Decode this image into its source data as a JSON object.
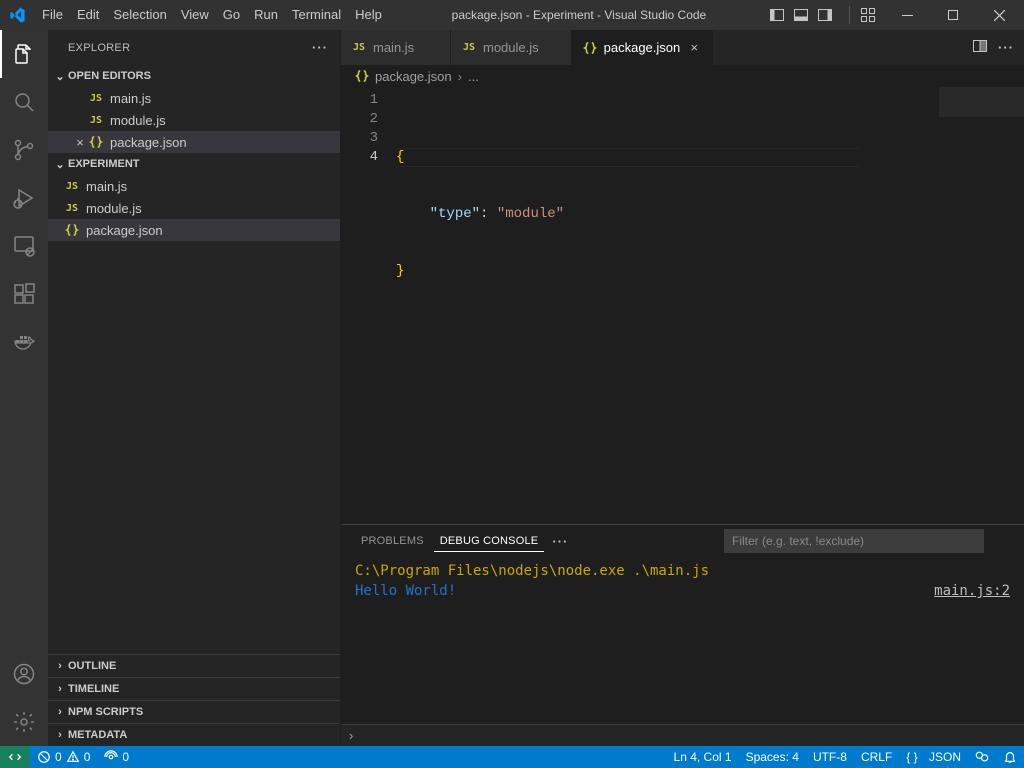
{
  "title": "package.json - Experiment - Visual Studio Code",
  "menu": [
    "File",
    "Edit",
    "Selection",
    "View",
    "Go",
    "Run",
    "Terminal",
    "Help"
  ],
  "explorer": {
    "title": "EXPLORER",
    "open_editors_label": "OPEN EDITORS",
    "open_editors": [
      {
        "name": "main.js",
        "icon": "js"
      },
      {
        "name": "module.js",
        "icon": "js"
      },
      {
        "name": "package.json",
        "icon": "json",
        "active": true
      }
    ],
    "project_label": "EXPERIMENT",
    "project_files": [
      {
        "name": "main.js",
        "icon": "js"
      },
      {
        "name": "module.js",
        "icon": "js"
      },
      {
        "name": "package.json",
        "icon": "json",
        "selected": true
      }
    ],
    "collapsed_sections": [
      "OUTLINE",
      "TIMELINE",
      "NPM SCRIPTS",
      "METADATA"
    ]
  },
  "tabs": [
    {
      "name": "main.js",
      "icon": "js"
    },
    {
      "name": "module.js",
      "icon": "js"
    },
    {
      "name": "package.json",
      "icon": "json",
      "active": true
    }
  ],
  "breadcrumb": {
    "file": "package.json",
    "more": "..."
  },
  "editor": {
    "line_numbers": [
      "1",
      "2",
      "3",
      "4"
    ],
    "l1": "{",
    "l2_indent": "    ",
    "l2_key": "\"type\"",
    "l2_sep": ": ",
    "l2_val": "\"module\"",
    "l3": "}",
    "current_line_index": 3
  },
  "panel": {
    "tabs": {
      "problems": "PROBLEMS",
      "debug": "DEBUG CONSOLE"
    },
    "filter_placeholder": "Filter (e.g. text, !exclude)",
    "line1": "C:\\Program Files\\nodejs\\node.exe .\\main.js",
    "line2": "Hello World!",
    "source_link": "main.js:2"
  },
  "status": {
    "errors": "0",
    "warnings": "0",
    "port": "0",
    "lncol": "Ln 4, Col 1",
    "spaces": "Spaces: 4",
    "encoding": "UTF-8",
    "eol": "CRLF",
    "lang_icon": "{ }",
    "lang": "JSON"
  }
}
